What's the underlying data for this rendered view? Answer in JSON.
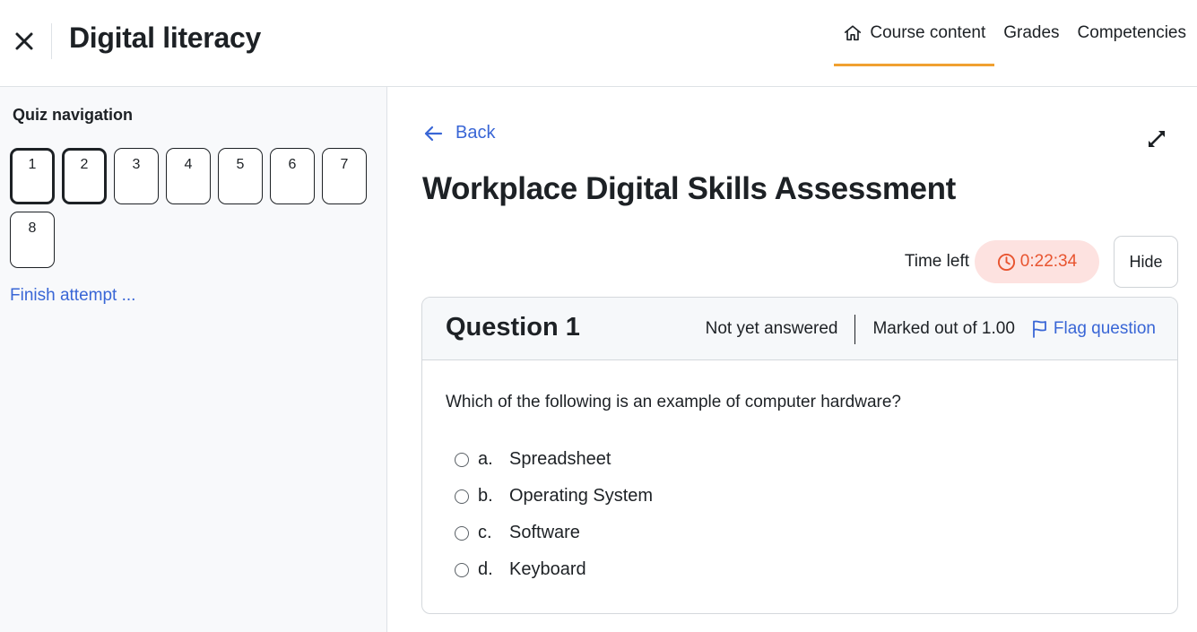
{
  "header": {
    "close_icon": "close-icon",
    "course_title": "Digital literacy",
    "tabs": [
      {
        "label": "Course content",
        "icon": "home-icon",
        "active": true
      },
      {
        "label": "Grades"
      },
      {
        "label": "Competencies"
      }
    ],
    "accent_color": "#f0a030"
  },
  "sidebar": {
    "title": "Quiz navigation",
    "questions": [
      "1",
      "2",
      "3",
      "4",
      "5",
      "6",
      "7",
      "8"
    ],
    "current_questions": [
      "1",
      "2"
    ],
    "finish_label": "Finish attempt ..."
  },
  "main": {
    "back_label": "Back",
    "quiz_title": "Workplace Digital Skills Assessment",
    "timer": {
      "label": "Time left",
      "value": "0:22:34",
      "color": "#e8542f"
    },
    "hide_label": "Hide",
    "question": {
      "title": "Question 1",
      "status": "Not yet answered",
      "marks": "Marked out of 1.00",
      "flag_label": "Flag question",
      "text": "Which of the following is an example of computer hardware?",
      "answers": [
        {
          "letter": "a.",
          "text": "Spreadsheet"
        },
        {
          "letter": "b.",
          "text": "Operating System"
        },
        {
          "letter": "c.",
          "text": "Software"
        },
        {
          "letter": "d.",
          "text": "Keyboard"
        }
      ]
    },
    "link_color": "#3966d6"
  }
}
